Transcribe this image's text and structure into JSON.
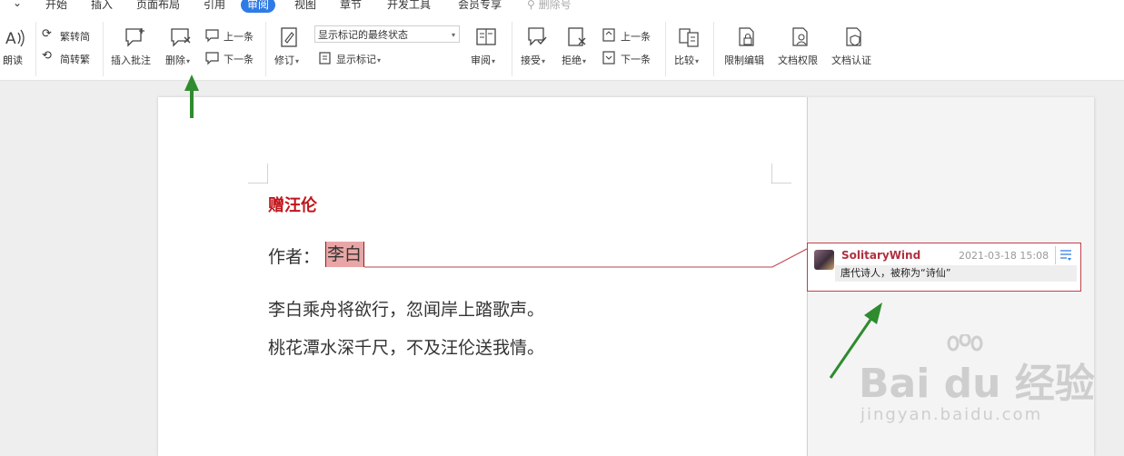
{
  "menu": {
    "items": [
      "开始",
      "插入",
      "页面布局",
      "引用",
      "审阅",
      "视图",
      "章节",
      "开发工具",
      "会员专享"
    ],
    "active": "审阅",
    "search_label": "删除号"
  },
  "ribbon": {
    "read_aloud": "朗读",
    "trad_to_simp": "繁转简",
    "simp_to_trad": "简转繁",
    "insert_comment": "插入批注",
    "delete": "删除",
    "prev_comment": "上一条",
    "next_comment": "下一条",
    "track_changes": "修订",
    "display_mode_value": "显示标记的最终状态",
    "show_markup": "显示标记",
    "review_pane": "审阅",
    "accept": "接受",
    "reject": "拒绝",
    "prev_change": "上一条",
    "next_change": "下一条",
    "compare": "比较",
    "restrict_editing": "限制编辑",
    "doc_permissions": "文档权限",
    "doc_certification": "文档认证"
  },
  "document": {
    "title": "赠汪伦",
    "author_label": "作者：",
    "author_name": "李白",
    "lines": [
      "李白乘舟将欲行，忽闻岸上踏歌声。",
      "桃花潭水深千尺，不及汪伦送我情。"
    ]
  },
  "comment": {
    "author": "SolitaryWind",
    "timestamp": "2021-03-18 15:08",
    "text": "唐代诗人，被称为“诗仙”"
  },
  "watermark": {
    "main": "Bai du 经验",
    "sub": "jingyan.baidu.com"
  },
  "colors": {
    "accent": "#2f7be5",
    "title_red": "#c0151b",
    "comment_border": "#c0404a",
    "highlight": "#e9a6a6",
    "arrow_green": "#2e8b2e"
  }
}
